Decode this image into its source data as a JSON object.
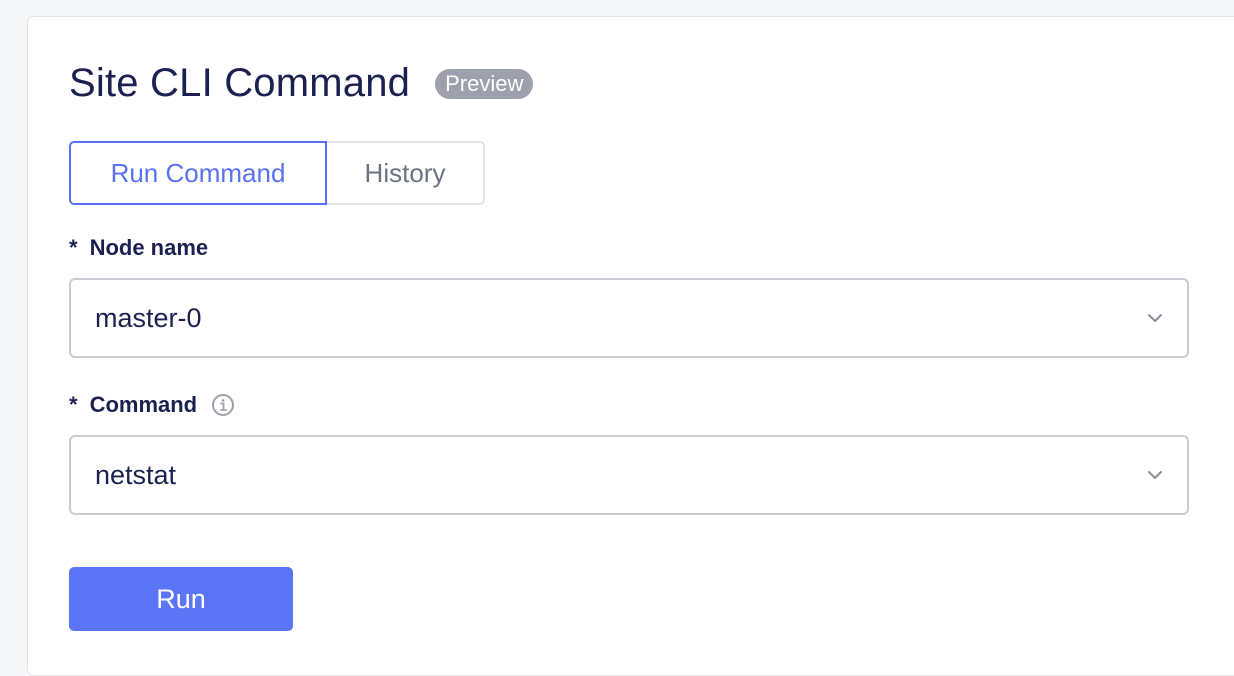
{
  "header": {
    "title": "Site CLI Command",
    "badge": "Preview"
  },
  "tabs": [
    {
      "label": "Run Command",
      "active": true
    },
    {
      "label": "History",
      "active": false
    }
  ],
  "form": {
    "required_marker": "*",
    "node_name": {
      "label": "Node name",
      "value": "master-0"
    },
    "command": {
      "label": "Command",
      "value": "netstat",
      "info_icon": "info-icon"
    },
    "run_label": "Run"
  },
  "colors": {
    "accent": "#5871f5",
    "button": "#5b75f7",
    "badge": "#9ca1ad",
    "text": "#1a2151"
  }
}
